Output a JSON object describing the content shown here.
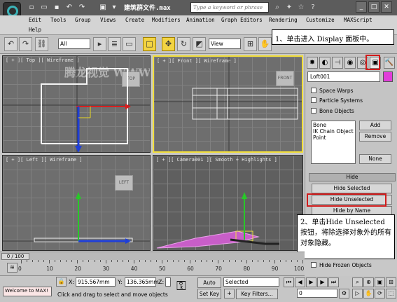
{
  "title": "建筑群文件.max",
  "search_placeholder": "Type a keyword or phrase",
  "menu": [
    "Edit",
    "Tools",
    "Group",
    "Views",
    "Create",
    "Modifiers",
    "Animation",
    "Graph Editors",
    "Rendering",
    "Customize",
    "MAXScript",
    "Help"
  ],
  "toolbar": {
    "filter_value": "All",
    "coord_value": "View"
  },
  "viewports": {
    "top": "[ + ][ Top ][ Wireframe ]",
    "front": "[ + ][ Front ][ Wireframe ]",
    "left": "[ + ][ Left ][ Wireframe ]",
    "camera": "[ + ][ Camera001 ][ Smooth + Highlights ]",
    "cube_top": "TOP",
    "cube_front": "FRONT",
    "cube_left": "LEFT",
    "watermark": "腾龙视觉 WWW.TLVI.NET"
  },
  "command_panel": {
    "object_name": "Loft001",
    "checkboxes": [
      "Space Warps",
      "Particle Systems",
      "Bone Objects"
    ],
    "list_items": [
      "Bone",
      "IK Chain Object",
      "Point"
    ],
    "add": "Add",
    "remove": "Remove",
    "none": "None",
    "rollout_hide": "Hide",
    "hide_selected": "Hide Selected",
    "hide_unselected": "Hide Unselected",
    "hide_by_name": "Hide by Name",
    "hide_frozen": "Hide Frozen Objects",
    "accent_color": "#e13ed9"
  },
  "callouts": {
    "step1": "1、单击进入 Display 面板中。",
    "step2": "2、单击Hide Unselected按钮，将除选择对象外的所有对象隐藏。"
  },
  "timeline": {
    "frame": "0 / 100",
    "ticks": [
      "0",
      "10",
      "20",
      "30",
      "40",
      "50",
      "60",
      "70",
      "80",
      "90",
      "100"
    ]
  },
  "status": {
    "welcome": "Welcome to MAX!",
    "x_label": "X:",
    "x_value": "915.567mm",
    "y_label": "Y:",
    "y_value": "136.365mm",
    "z_label": "Z:",
    "auto_key": "Auto Key",
    "key_mode": "Selected",
    "set_key": "Set Key",
    "key_filters": "Key Filters...",
    "frame_value": "0",
    "prompt": "Click and drag to select and move objects"
  }
}
